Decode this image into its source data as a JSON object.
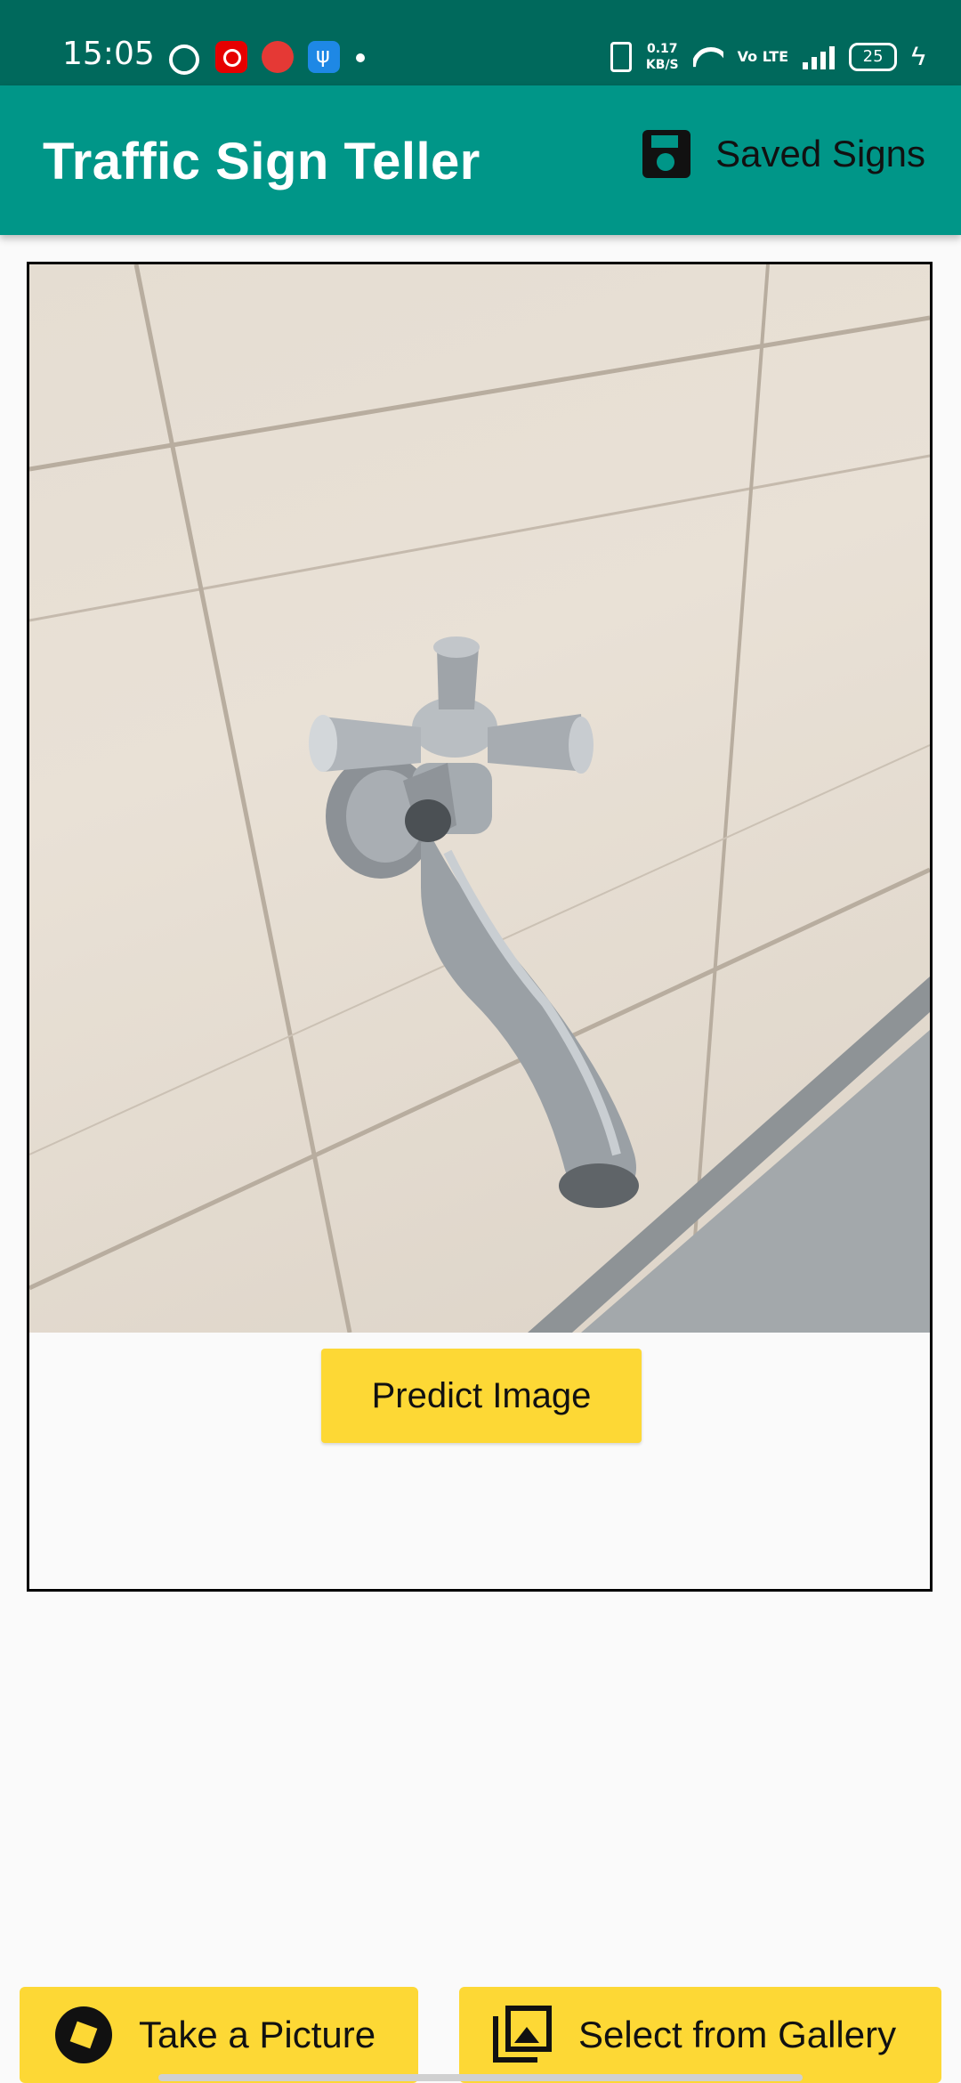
{
  "status_bar": {
    "time": "15:05",
    "speed_value": "0.17",
    "speed_unit": "KB/S",
    "volte": "Vo LTE",
    "battery": "25"
  },
  "app_bar": {
    "title": "Traffic Sign Teller",
    "saved_label": "Saved Signs",
    "saved_icon": "save-icon",
    "bg_color": "#009688"
  },
  "preview": {
    "image_subject": "faucet on tiled wall",
    "predict_label": "Predict Image"
  },
  "actions": {
    "take_picture_label": "Take a Picture",
    "take_picture_icon": "camera-shutter-icon",
    "gallery_label": "Select from Gallery",
    "gallery_icon": "photo-library-icon",
    "button_color": "#fdd835"
  }
}
